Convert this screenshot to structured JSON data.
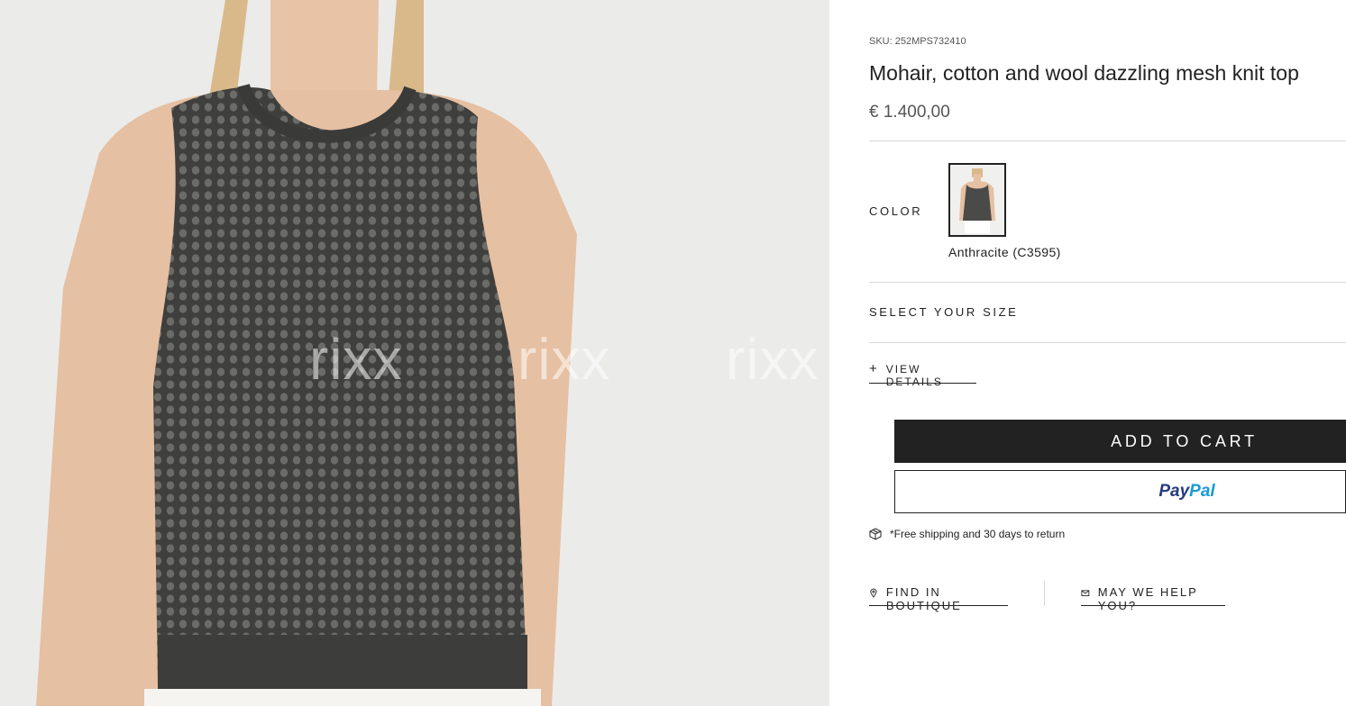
{
  "product": {
    "sku": "SKU: 252MPS732410",
    "title": "Mohair, cotton and wool dazzling mesh knit top",
    "price": "€ 1.400,00"
  },
  "color": {
    "label": "COLOR",
    "selected_name": "Anthracite (C3595)"
  },
  "size": {
    "label": "SELECT YOUR SIZE"
  },
  "details": {
    "toggle_icon": "+",
    "label": "VIEW DETAILS"
  },
  "actions": {
    "add_to_cart": "ADD TO CART",
    "paypal_part1": "Pay",
    "paypal_part2": "Pal"
  },
  "shipping": {
    "icon": "package-icon",
    "text": "*Free shipping and 30 days to return"
  },
  "links": {
    "boutique": {
      "icon": "location-pin-icon",
      "label": "FIND IN BOUTIQUE"
    },
    "help": {
      "icon": "envelope-icon",
      "label": "MAY WE HELP YOU?"
    }
  },
  "gallery": {
    "watermarks": [
      "rixx",
      "rixx",
      "rixx"
    ]
  },
  "colors": {
    "text": "#222222",
    "muted": "#555555",
    "divider": "#d8d8d8",
    "cart_bg": "#222222",
    "paypal_dark": "#253b80",
    "paypal_light": "#179bd7"
  }
}
